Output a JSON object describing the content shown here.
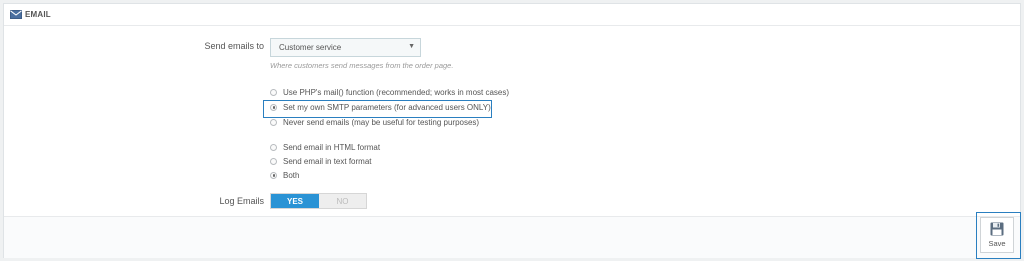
{
  "panel": {
    "title": "EMAIL",
    "icon": "envelope-icon"
  },
  "send_to": {
    "label": "Send emails to",
    "selected": "Customer service",
    "help": "Where customers send messages from the order page."
  },
  "mail_method": {
    "options": [
      {
        "label": "Use PHP's mail() function (recommended; works in most cases)",
        "checked": false
      },
      {
        "label": "Set my own SMTP parameters (for advanced users ONLY)",
        "checked": true
      },
      {
        "label": "Never send emails (may be useful for testing purposes)",
        "checked": false
      }
    ]
  },
  "mail_format": {
    "options": [
      {
        "label": "Send email in HTML format",
        "checked": false
      },
      {
        "label": "Send email in text format",
        "checked": false
      },
      {
        "label": "Both",
        "checked": true
      }
    ]
  },
  "log_emails": {
    "label": "Log Emails",
    "yes": "YES",
    "no": "NO",
    "value": "YES"
  },
  "footer": {
    "save_label": "Save",
    "save_icon": "floppy-disk-icon"
  },
  "colors": {
    "accent": "#2a93d5",
    "highlight": "#2a7fc0"
  }
}
